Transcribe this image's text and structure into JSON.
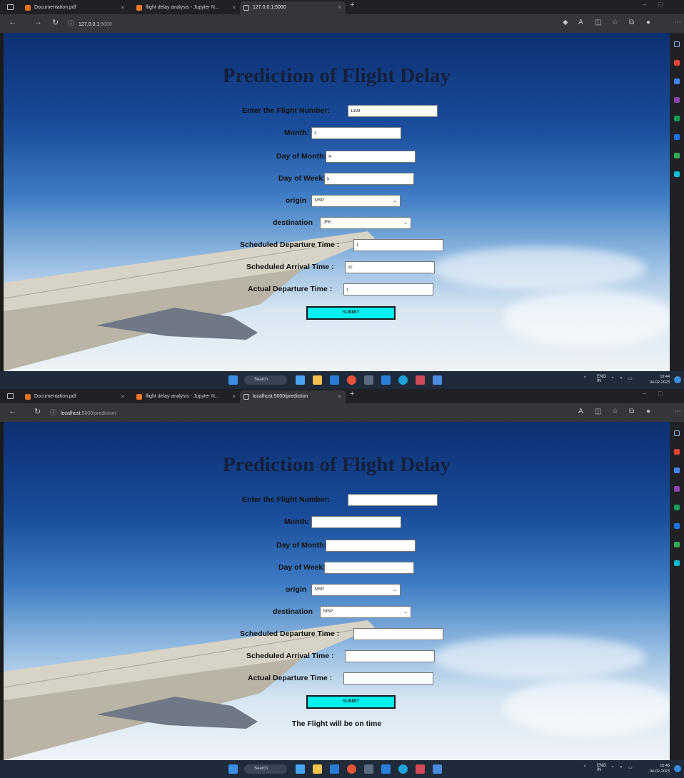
{
  "screens": [
    {
      "tabs": [
        {
          "label": "Documentation.pdf"
        },
        {
          "label": "flight delay analysis - Jupyter N..."
        },
        {
          "label": "127.0.0.1:5000"
        }
      ],
      "url": {
        "host": "127.0.0.1",
        "rest": ":5000"
      },
      "title": "Prediction of Flight Delay",
      "fields": {
        "flight_number": {
          "label": "Enter the Flight Number:",
          "value": "1399"
        },
        "month": {
          "label": "Month:",
          "value": "1"
        },
        "day_of_month": {
          "label": "Day of Month:",
          "value": "4"
        },
        "day_of_week": {
          "label": "Day of Week:",
          "value": "5"
        },
        "origin": {
          "label": "origin",
          "value": "MSP"
        },
        "destination": {
          "label": "destination",
          "value": "JFK"
        },
        "sched_dep": {
          "label": "Scheduled Departure Time :",
          "value": "1"
        },
        "sched_arr": {
          "label": "Scheduled Arrival Time :",
          "value": "22"
        },
        "actual_dep": {
          "label": "Actual Departure Time :",
          "value": "1"
        }
      },
      "submit": "SUBMIT",
      "result": "",
      "taskbar": {
        "search": "Search",
        "lang": "ENG\nIN",
        "time": "10:44",
        "date": "04-02-2023"
      }
    },
    {
      "tabs": [
        {
          "label": "Documentation.pdf"
        },
        {
          "label": "flight delay analysis - Jupyter N..."
        },
        {
          "label": "localhost:5000/prediction"
        }
      ],
      "url": {
        "host": "localhost",
        "rest": ":5000/prediction"
      },
      "title": "Prediction of Flight Delay",
      "fields": {
        "flight_number": {
          "label": "Enter the Flight Number:",
          "value": ""
        },
        "month": {
          "label": "Month:",
          "value": ""
        },
        "day_of_month": {
          "label": "Day of Month:",
          "value": ""
        },
        "day_of_week": {
          "label": "Day of Week:",
          "value": ""
        },
        "origin": {
          "label": "origin",
          "value": "MSP"
        },
        "destination": {
          "label": "destination",
          "value": "MSP"
        },
        "sched_dep": {
          "label": "Scheduled Departure Time :",
          "value": ""
        },
        "sched_arr": {
          "label": "Scheduled Arrival Time :",
          "value": ""
        },
        "actual_dep": {
          "label": "Actual Departure Time :",
          "value": ""
        }
      },
      "submit": "SUBMIT",
      "result": "The Flight will be on time",
      "taskbar": {
        "search": "Search",
        "lang": "ENG\nIN",
        "time": "10:45",
        "date": "04-02-2023"
      }
    }
  ],
  "colors": {
    "submit_bg": "#00f0f0",
    "title": "#14203d",
    "sky_top": "#0d2f72",
    "sky_bottom": "#eef3f7"
  },
  "icons": [
    "window-icon",
    "pdf-tab-icon",
    "jupyter-tab-icon",
    "page-tab-icon",
    "back-icon",
    "forward-icon",
    "reload-icon",
    "info-icon",
    "extension-icon",
    "favorite-icon",
    "collections-icon",
    "profile-icon",
    "start-icon",
    "search-icon",
    "wifi-icon",
    "volume-icon",
    "battery-icon"
  ]
}
